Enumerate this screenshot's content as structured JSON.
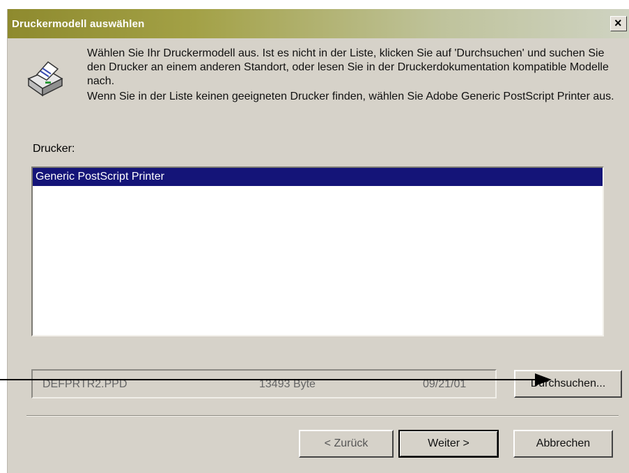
{
  "window": {
    "title": "Druckermodell auswählen",
    "close_symbol": "×"
  },
  "icons": {
    "printer": "printer-icon",
    "close": "close-icon",
    "arrow": "annotation-arrow"
  },
  "intro": {
    "paragraph1": "Wählen Sie Ihr Druckermodell aus. Ist es nicht in der Liste, klicken Sie auf 'Durchsuchen' und suchen Sie den Drucker an einem anderen Standort, oder lesen Sie in der Druckerdokumentation kompatible Modelle nach.",
    "paragraph2": "Wenn Sie in der Liste keinen geeigneten Drucker finden, wählen Sie Adobe Generic PostScript Printer aus."
  },
  "printers": {
    "label": "Drucker:",
    "items": [
      "Generic PostScript Printer"
    ],
    "selected": "Generic PostScript Printer"
  },
  "file": {
    "name": "DEFPRTR2.PPD",
    "size": "13493 Byte",
    "date": "09/21/01"
  },
  "buttons": {
    "browse": "Durchsuchen...",
    "back": "< Zurück",
    "next": "Weiter >",
    "cancel": "Abbrechen"
  },
  "colors": {
    "dialog_bg": "#d6d2c9",
    "titlebar_start": "#8e8a2e",
    "titlebar_end": "#cfd3c2",
    "selection": "#141478"
  }
}
